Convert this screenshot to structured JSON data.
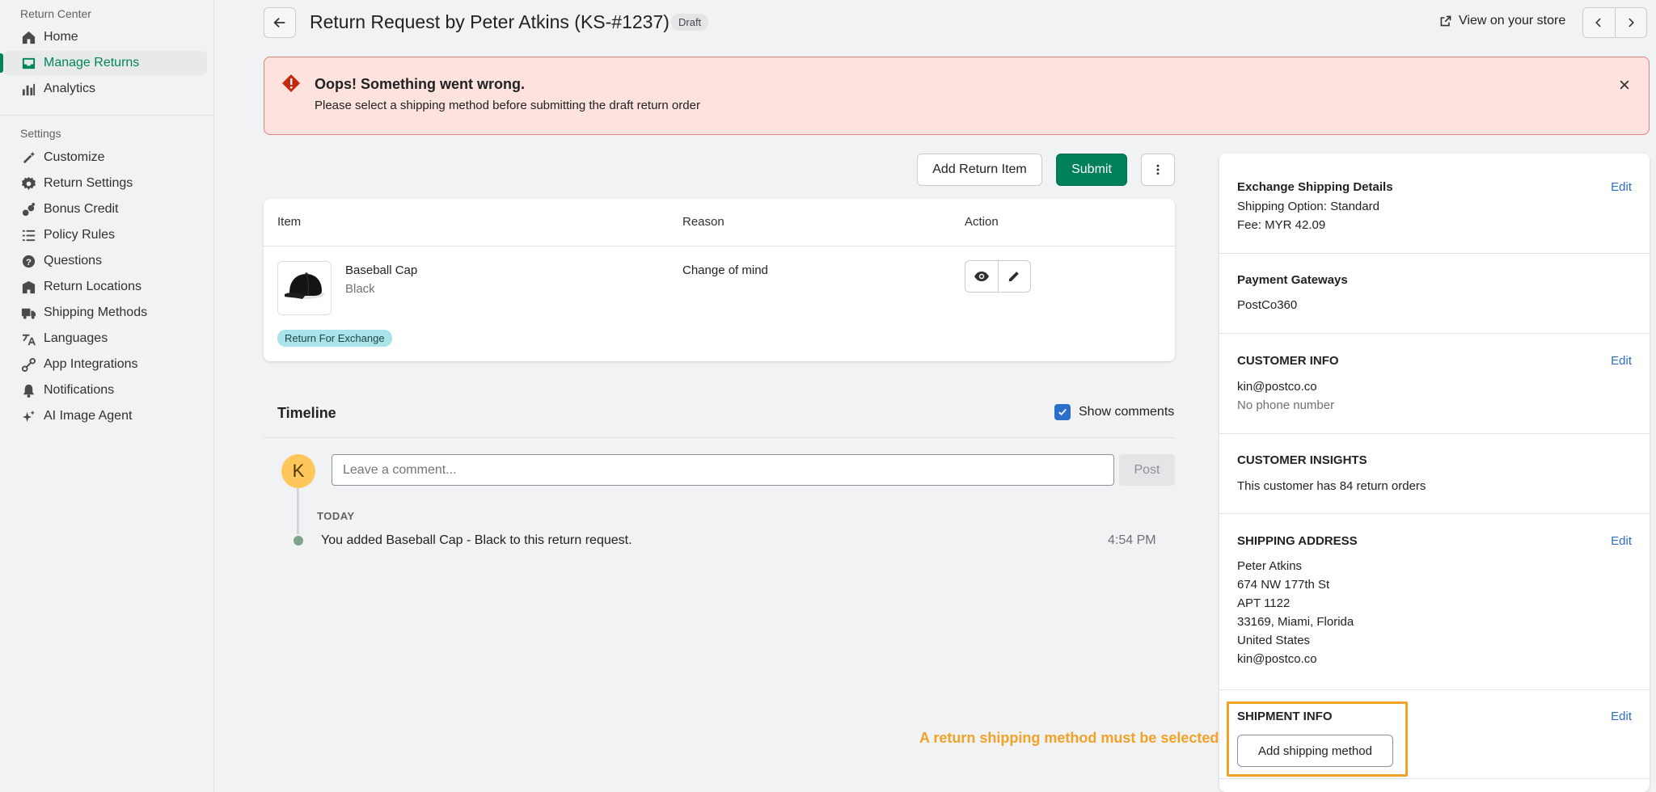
{
  "sidebar": {
    "section1_title": "Return Center",
    "items1": [
      {
        "label": "Home",
        "icon": "home-icon"
      },
      {
        "label": "Manage Returns",
        "icon": "inbox-icon"
      },
      {
        "label": "Analytics",
        "icon": "bar-chart-icon"
      }
    ],
    "section2_title": "Settings",
    "items2": [
      {
        "label": "Customize",
        "icon": "wand-icon"
      },
      {
        "label": "Return Settings",
        "icon": "gear-icon"
      },
      {
        "label": "Bonus Credit",
        "icon": "coins-icon"
      },
      {
        "label": "Policy Rules",
        "icon": "list-icon"
      },
      {
        "label": "Questions",
        "icon": "question-icon"
      },
      {
        "label": "Return Locations",
        "icon": "building-icon"
      },
      {
        "label": "Shipping Methods",
        "icon": "truck-icon"
      },
      {
        "label": "Languages",
        "icon": "translate-icon"
      },
      {
        "label": "App Integrations",
        "icon": "integration-icon"
      },
      {
        "label": "Notifications",
        "icon": "bell-icon"
      },
      {
        "label": "AI Image Agent",
        "icon": "sparkle-icon"
      }
    ]
  },
  "header": {
    "title": "Return Request by Peter Atkins (KS-#1237)",
    "badge": "Draft",
    "view_store": "View on your store"
  },
  "banner": {
    "title": "Oops! Something went wrong.",
    "message": "Please select a shipping method before submitting the draft return order"
  },
  "toolbar": {
    "add_item": "Add Return Item",
    "submit": "Submit"
  },
  "items_table": {
    "headers": {
      "item": "Item",
      "reason": "Reason",
      "action": "Action"
    },
    "row": {
      "name": "Baseball Cap",
      "variant": "Black",
      "reason": "Change of mind",
      "badge": "Return For Exchange"
    }
  },
  "timeline": {
    "title": "Timeline",
    "show_comments": "Show comments",
    "avatar_initial": "K",
    "comment_placeholder": "Leave a comment...",
    "post": "Post",
    "day": "TODAY",
    "event": "You added Baseball Cap - Black to this return request.",
    "time": "4:54 PM"
  },
  "side": {
    "exchange": {
      "title": "Exchange Shipping Details",
      "option": "Shipping Option: Standard",
      "fee": "Fee: MYR 42.09",
      "edit": "Edit"
    },
    "payment": {
      "title": "Payment Gateways",
      "value": "PostCo360"
    },
    "customer": {
      "title": "CUSTOMER INFO",
      "email": "kin@postco.co",
      "phone": "No phone number",
      "edit": "Edit"
    },
    "insights": {
      "title": "CUSTOMER INSIGHTS",
      "text": "This customer has 84 return orders"
    },
    "address": {
      "title": "SHIPPING ADDRESS",
      "edit": "Edit",
      "lines": [
        "Peter Atkins",
        "674 NW 177th St",
        "APT 1122",
        "33169, Miami, Florida",
        "United States",
        "kin@postco.co"
      ]
    },
    "shipment": {
      "title": "SHIPMENT INFO",
      "edit": "Edit",
      "button": "Add shipping method"
    }
  },
  "annotation": "A return shipping method must be selected",
  "colors": {
    "accent_green": "#00805a",
    "link_blue": "#2c6ecb",
    "banner_bg": "#fde2dd",
    "highlight_orange": "#f2a227"
  }
}
